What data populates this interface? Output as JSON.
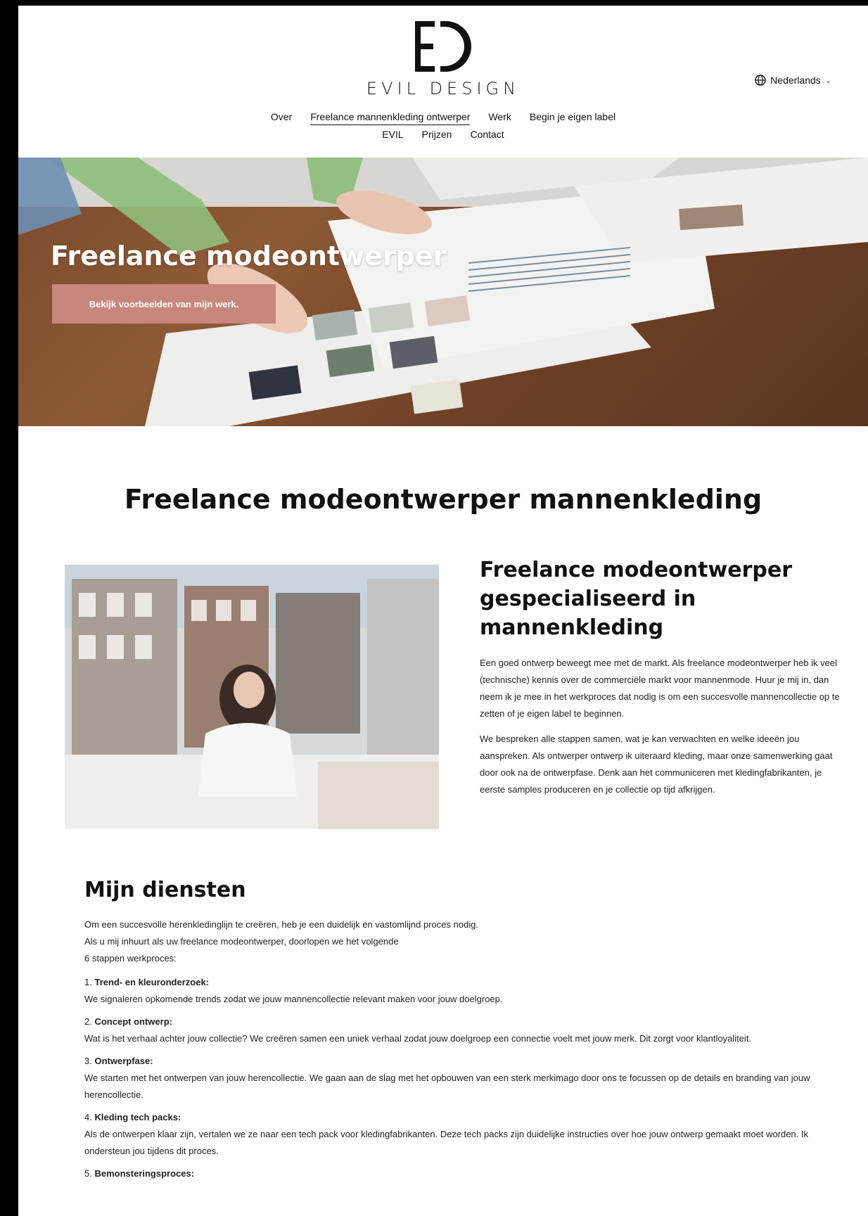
{
  "brand": {
    "logo_text": "EVIL DESIGN",
    "text_color": "#111111"
  },
  "language": {
    "label": "Nederlands",
    "icon": "globe-icon"
  },
  "nav": {
    "row1": [
      "Over",
      "Freelance mannenkleding ontwerper",
      "Werk",
      "Begin je eigen label"
    ],
    "row2": [
      "EVIL",
      "Prijzen",
      "Contact"
    ],
    "active": "Freelance mannenkleding ontwerper"
  },
  "hero": {
    "title": "Freelance modeontwerper",
    "button_label": "Bekijk voorbeelden van mijn werk.",
    "button_color": "#c8867d"
  },
  "main": {
    "title": "Freelance modeontwerper mannenkleding",
    "intro_heading": "Freelance modeontwerper gespecialiseerd in mannenkleding",
    "paragraphs": [
      "Een goed ontwerp beweegt mee met de markt. Als freelance modeontwerper heb ik veel (technische) kennis over de commerciële markt voor mannenmode. Huur je mij in, dan neem ik je mee in het werkproces dat nodig is om een succesvolle mannencollectie op te zetten of je eigen label te beginnen.",
      "We bespreken alle stappen samen, wat je kan verwachten en welke ideeën jou aanspreken. Als ontwerper ontwerp ik uiteraard kleding, maar onze samenwerking gaat door ook na de ontwerpfase. Denk aan het communiceren met kledingfabrikanten, je eerste samples produceren en je collectie op tijd afkrijgen."
    ]
  },
  "services": {
    "heading": "Mijn diensten",
    "lead_lines": [
      "Om een succesvolle herenkledinglijn te creëren, heb je een duidelijk en vastomlijnd proces nodig.",
      "Als u mij inhuurt als uw freelance modeontwerper, doorlopen we het volgende",
      "6 stappen werkproces:"
    ],
    "steps": [
      {
        "num": "1.",
        "title": "Trend- en kleuronderzoek:",
        "text": "We signaleren opkomende trends zodat we jouw mannencollectie relevant maken voor jouw doelgroep."
      },
      {
        "num": "2.",
        "title": "Concept ontwerp:",
        "text": "Wat is het verhaal achter jouw collectie? We creëren samen een uniek verhaal zodat jouw doelgroep een connectie voelt met jouw merk. Dit zorgt voor klantloyaliteit."
      },
      {
        "num": "3.",
        "title": "Ontwerpfase:",
        "text": "We starten met het ontwerpen van jouw herencollectie. We gaan aan de slag met het opbouwen van een sterk merkimago door ons te focussen op de details en branding van jouw herencollectie."
      },
      {
        "num": "4.",
        "title": "Kleding tech packs:",
        "text": "Als de ontwerpen klaar zijn, vertalen we ze naar een tech pack voor kledingfabrikanten. Deze tech packs zijn duidelijke instructies over hoe jouw ontwerp gemaakt moet worden. Ik ondersteun jou tijdens dit proces."
      },
      {
        "num": "5.",
        "title": "Bemonsteringsproces:",
        "text": ""
      }
    ]
  }
}
